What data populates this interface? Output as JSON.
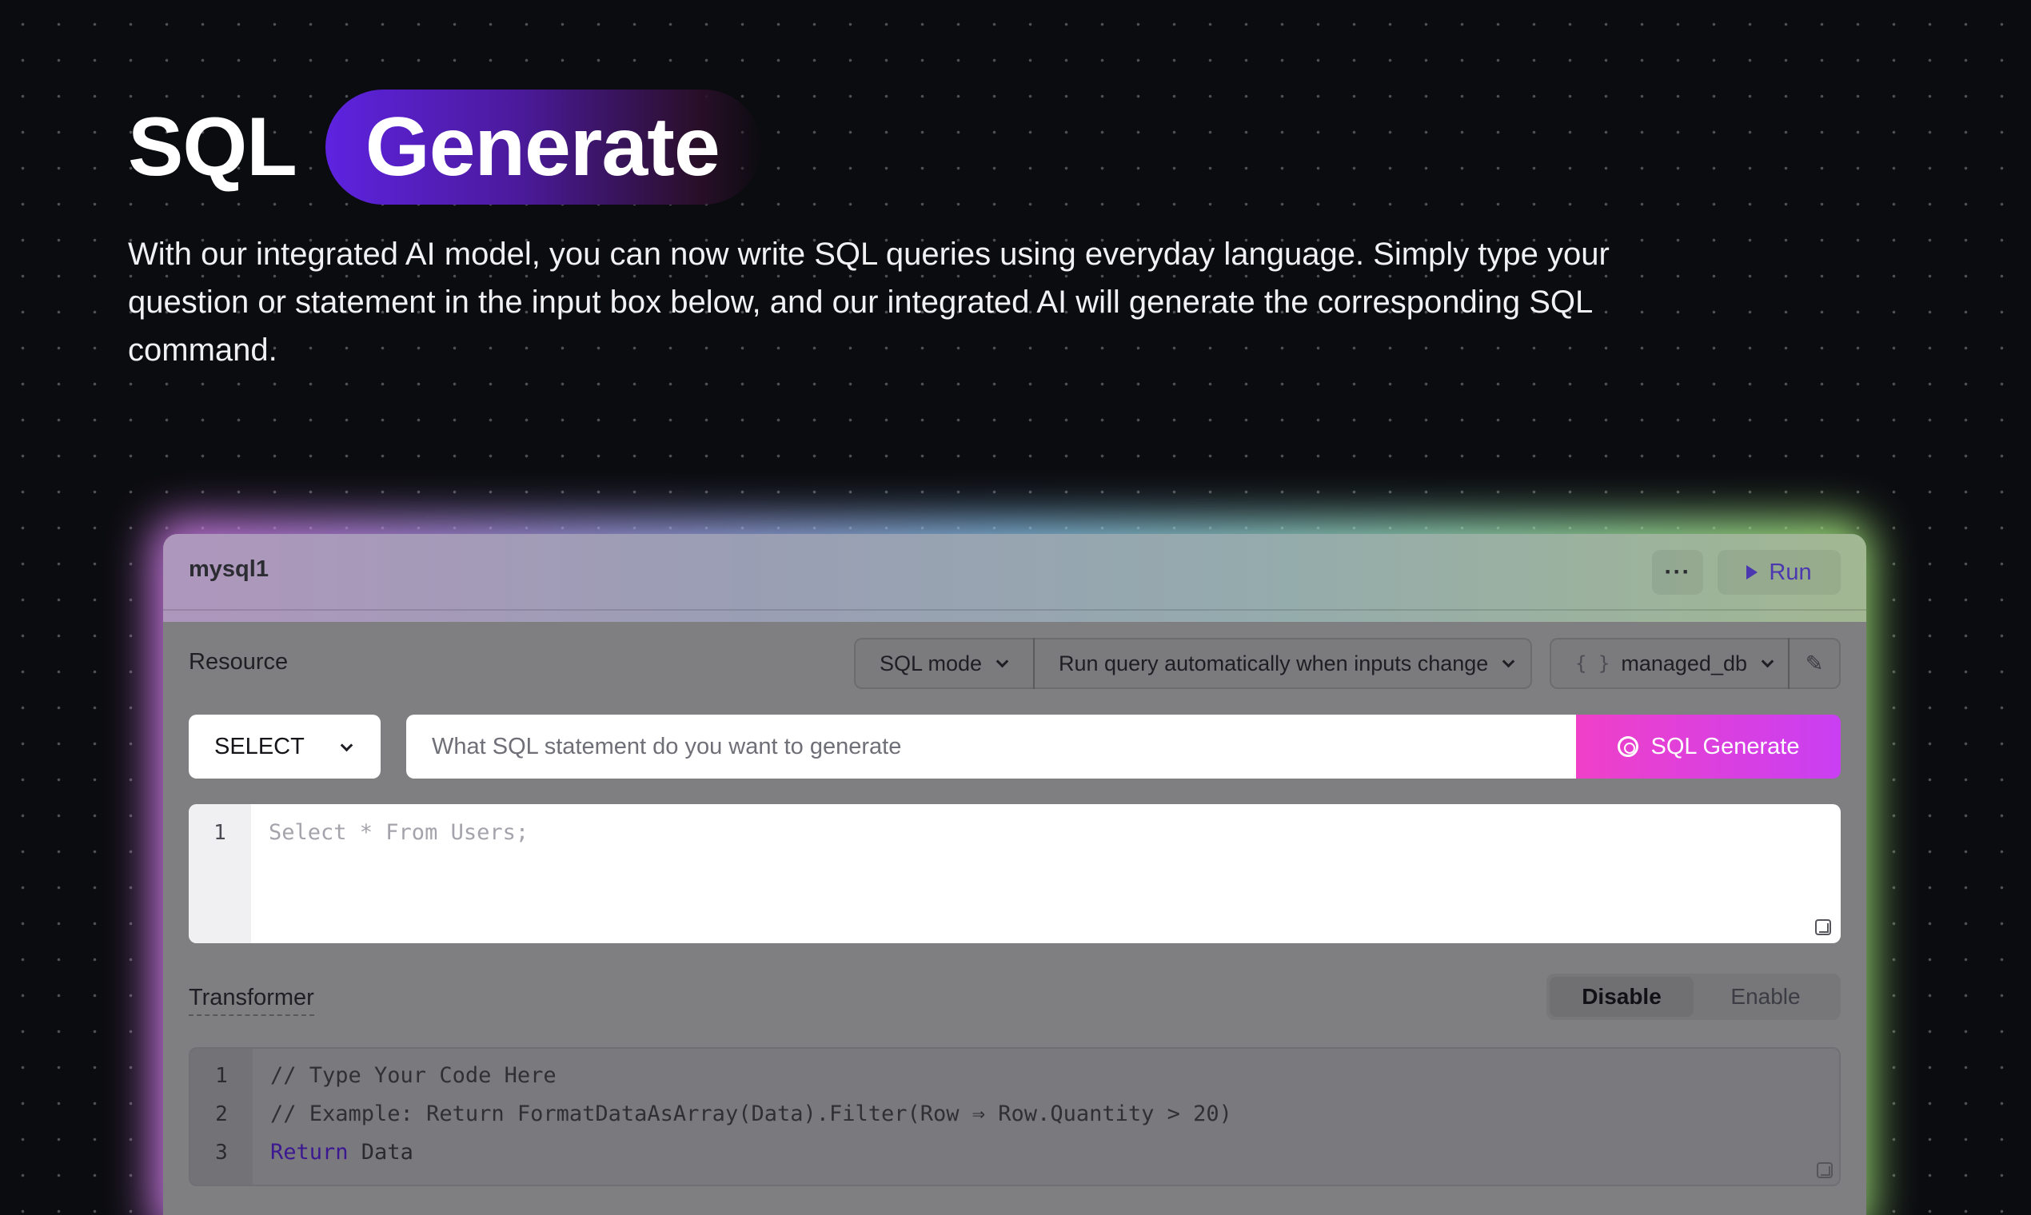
{
  "hero": {
    "title_plain": "SQL",
    "title_pill": "Generate",
    "description": "With our integrated AI model, you can now write SQL queries using everyday language. Simply type your question or statement in the input box below, and our integrated AI will generate the corresponding SQL command."
  },
  "panel": {
    "name": "mysql1",
    "more_label": "···",
    "run_label": "Run",
    "resource_label": "Resource",
    "sql_mode": "SQL mode",
    "auto_run": "Run query automatically when inputs change",
    "database": "managed_db",
    "db_icon": "{ }",
    "edit_icon": "✎",
    "statement_type": "SELECT",
    "prompt_placeholder": "What SQL statement do you want to generate",
    "generate_label": "SQL Generate",
    "editor": {
      "line_numbers": [
        "1"
      ],
      "placeholder": "Select * From Users;"
    },
    "transformer_label": "Transformer",
    "toggle": {
      "disable": "Disable",
      "enable": "Enable",
      "selected": "Disable"
    },
    "transformer_code": {
      "line_numbers": [
        "1",
        "2",
        "3"
      ],
      "line1": "// Type Your Code Here",
      "line2": "// Example: Return FormatDataAsArray(Data).Filter(Row ⇒ Row.Quantity > 20)",
      "line3_keyword": "Return",
      "line3_rest": " Data"
    }
  },
  "colors": {
    "background": "#0b0c10",
    "pill_start": "#5e23e0",
    "generate_button": "#f040c8",
    "run_accent": "#4b38b0"
  }
}
